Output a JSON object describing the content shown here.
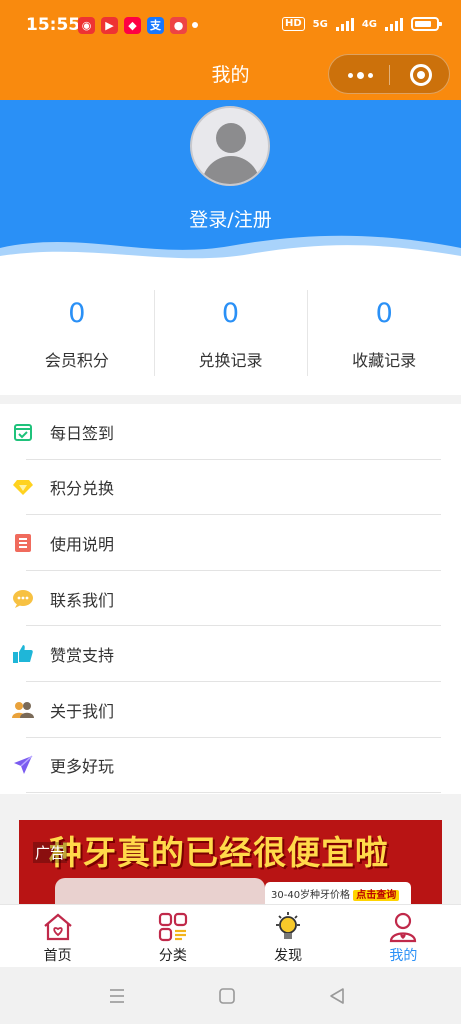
{
  "status_bar": {
    "time": "15:55",
    "network": "5G",
    "hd_label": "HD",
    "data_speed": "4G"
  },
  "nav": {
    "title": "我的"
  },
  "profile": {
    "login_label": "登录/注册"
  },
  "stats": [
    {
      "value": "0",
      "label": "会员积分"
    },
    {
      "value": "0",
      "label": "兑换记录"
    },
    {
      "value": "0",
      "label": "收藏记录"
    }
  ],
  "menu": [
    {
      "label": "每日签到",
      "icon": "calendar-check-icon"
    },
    {
      "label": "积分兑换",
      "icon": "diamond-icon"
    },
    {
      "label": "使用说明",
      "icon": "list-icon"
    },
    {
      "label": "联系我们",
      "icon": "chat-bubble-icon"
    },
    {
      "label": "赞赏支持",
      "icon": "thumbs-up-icon"
    },
    {
      "label": "关于我们",
      "icon": "users-icon"
    },
    {
      "label": "更多好玩",
      "icon": "paper-plane-icon"
    }
  ],
  "ad": {
    "tag": "广告",
    "headline": "种牙真的已经很便宜啦",
    "card_text": "30-40岁种牙价格",
    "card_button": "点击查询"
  },
  "tabs": [
    {
      "label": "首页",
      "icon": "home-heart-icon"
    },
    {
      "label": "分类",
      "icon": "category-grid-icon"
    },
    {
      "label": "发现",
      "icon": "lightbulb-icon"
    },
    {
      "label": "我的",
      "icon": "user-heart-icon",
      "active": true
    }
  ],
  "colors": {
    "title_bar": "#f98a0e",
    "brand_blue": "#2a90f6",
    "tab_red": "#c0294a"
  }
}
